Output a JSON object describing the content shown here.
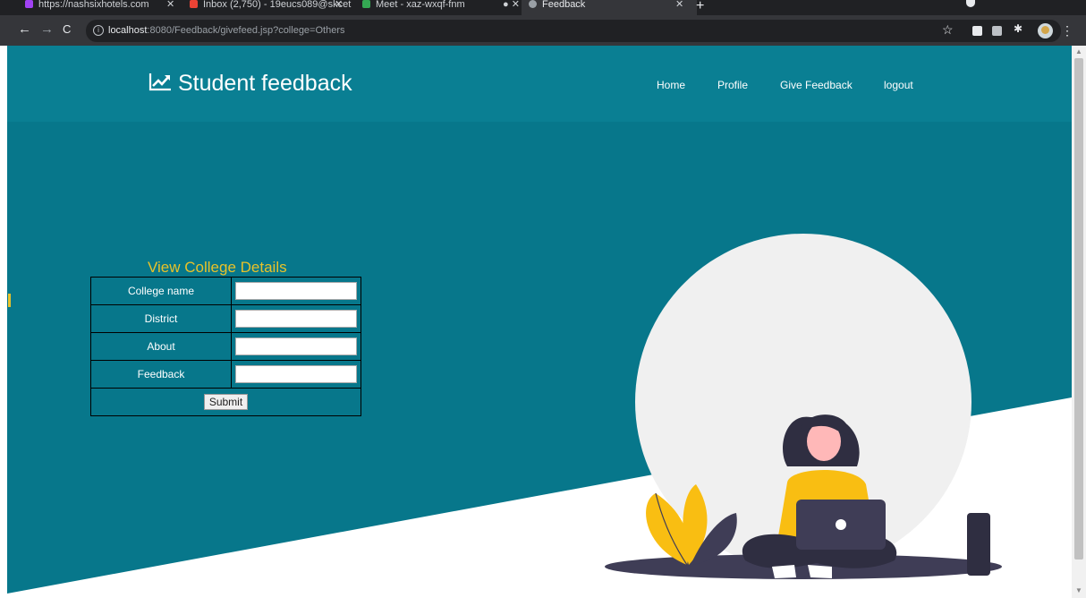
{
  "browser": {
    "tabs": [
      {
        "label": "https://nashsixhotels.com",
        "favicon_color": "#a142f4"
      },
      {
        "label": "Inbox (2,750) - 19eucs089@skcet",
        "favicon_color": "#ea4335"
      },
      {
        "label": "Meet - xaz-wxqf-fnm",
        "favicon_color": "#34a853"
      },
      {
        "label": "Feedback",
        "favicon_color": "#9aa0a6",
        "active": true
      }
    ],
    "url_host": "localhost",
    "url_rest": ":8080/Feedback/givefeed.jsp?college=Others",
    "icons": [
      "back-icon",
      "forward-icon",
      "reload-icon",
      "info-icon",
      "star-icon",
      "extension-icon",
      "puzzle-icon",
      "avatar",
      "kebab-menu-icon"
    ]
  },
  "site": {
    "brand": "Student feedback",
    "brand_icon": "trending-up-icon",
    "nav": [
      "Home",
      "Profile",
      "Give Feedback",
      "logout"
    ]
  },
  "form": {
    "title": "View College Details",
    "fields": [
      {
        "label": "College name",
        "value": ""
      },
      {
        "label": "District",
        "value": ""
      },
      {
        "label": "About",
        "value": ""
      },
      {
        "label": "Feedback",
        "value": ""
      }
    ],
    "submit_label": "Submit"
  },
  "colors": {
    "primary_teal": "#07778b",
    "header_teal": "#0a7f93",
    "accent_yellow": "#e8c22a",
    "illustration_dark": "#3f3d56",
    "illustration_yellow": "#f9be12"
  }
}
